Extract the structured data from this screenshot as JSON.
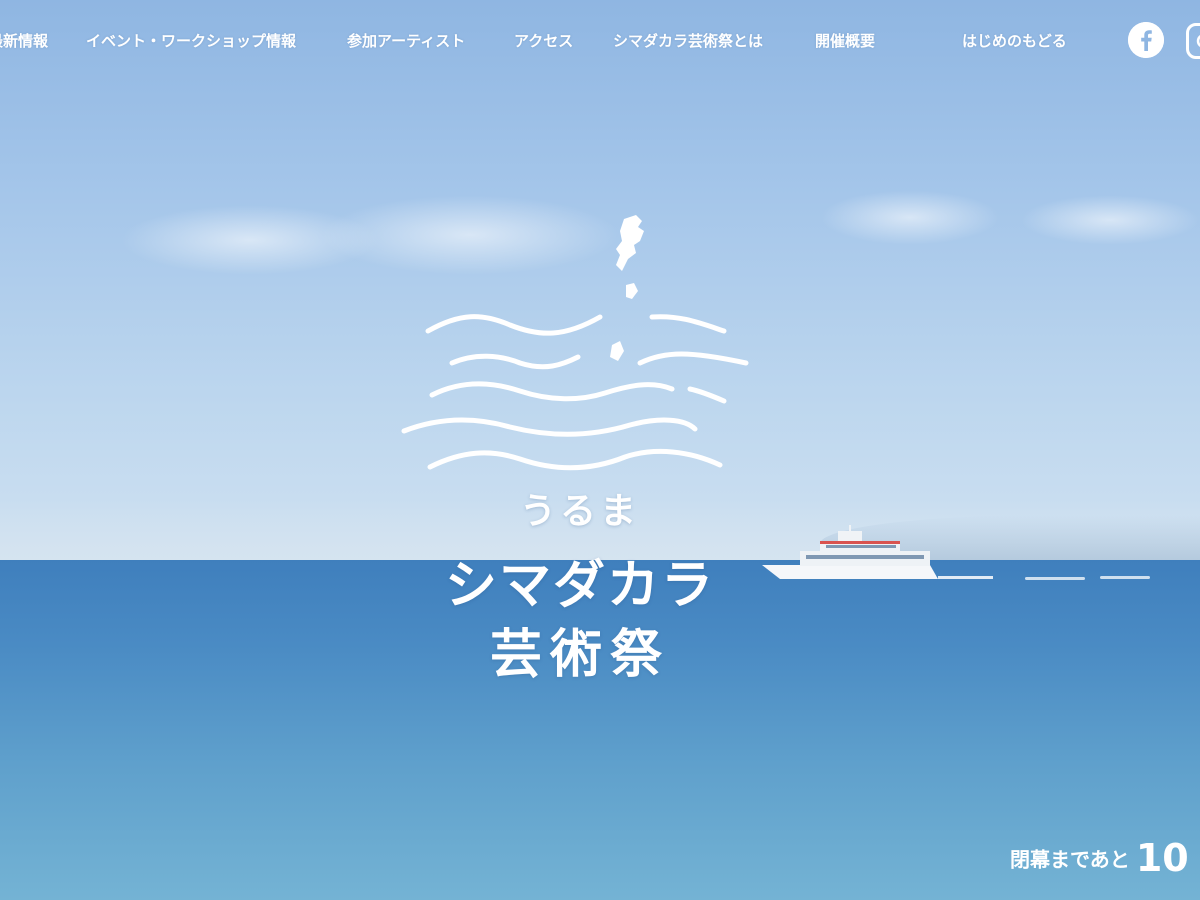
{
  "nav": {
    "items": [
      {
        "label": "最新情報"
      },
      {
        "label": "イベント・ワークショップ情報"
      },
      {
        "label": "参加アーティスト"
      },
      {
        "label": "アクセス"
      },
      {
        "label": "シマダカラ芸術祭とは"
      },
      {
        "label": "開催概要"
      },
      {
        "label": "はじめのもどる"
      }
    ],
    "social": [
      {
        "icon": "facebook-icon"
      },
      {
        "icon": "instagram-icon"
      }
    ]
  },
  "hero": {
    "title_line1": "うるま",
    "title_line2": "シマダカラ",
    "title_line3": "芸術祭"
  },
  "countdown": {
    "label": "閉幕まであと",
    "value": "10"
  },
  "colors": {
    "text": "#ffffff",
    "sky": "#a5c6ea",
    "sea": "#4a8bc4"
  }
}
